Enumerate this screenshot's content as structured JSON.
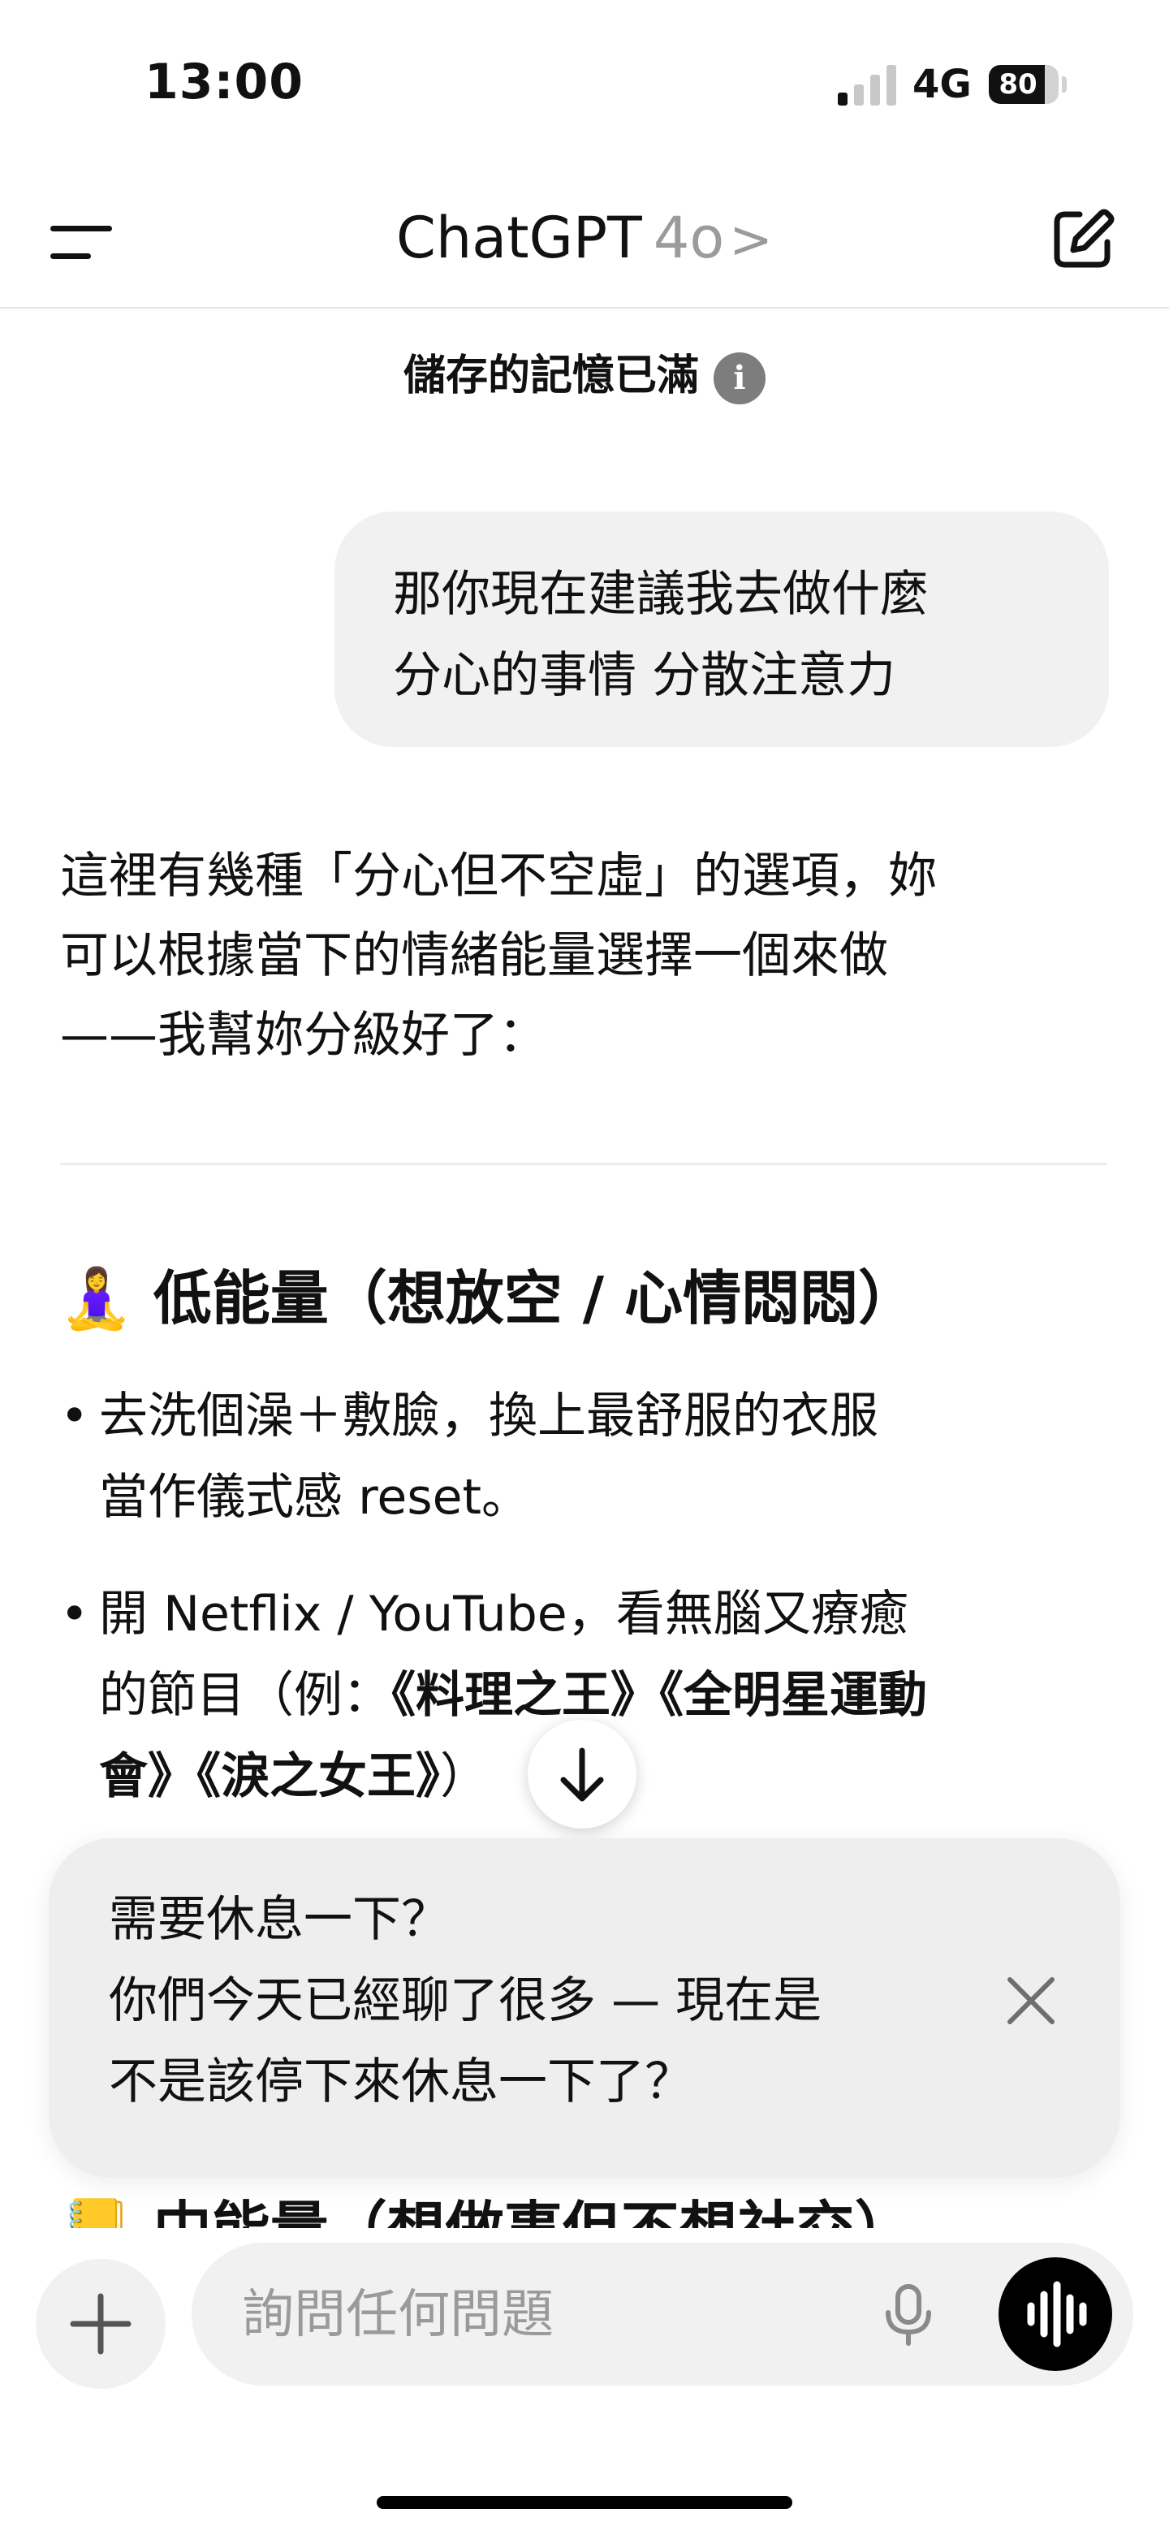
{
  "status_bar": {
    "time": "13:00",
    "network": "4G",
    "battery": "80",
    "battery_level": 0.8,
    "signal_bars_active": 1
  },
  "header": {
    "title": "ChatGPT",
    "model": "4o",
    "chevron": ">"
  },
  "memory_notice": {
    "text": "儲存的記憶已滿",
    "icon": "i"
  },
  "user_message": {
    "line1": "那你現在建議我去做什麼",
    "line2": "分心的事情 分散注意力"
  },
  "assistant": {
    "intro": [
      "這裡有幾種「分心但不空虛」的選項，妳",
      "可以根據當下的情緒能量選擇一個來做",
      "——我幫妳分級好了："
    ],
    "section_heading": "🧘‍♀️ 低能量（想放空 / 心情悶悶）",
    "bullets": [
      {
        "line1": "去洗個澡＋敷臉，換上最舒服的衣服",
        "line2": "當作儀式感 reset。"
      },
      {
        "line1": "開 Netflix / YouTube，看無腦又療癒",
        "line2_prefix": "的節目（例：",
        "line2_bold": "《料理之王》《全明星運動",
        "line3_bold": "會》《淚之女王》",
        "line3_suffix": "）"
      }
    ],
    "next_section_heading": "📒 中能量（想做事但不想社交）"
  },
  "break_card": {
    "title": "需要休息一下？",
    "body_line1": "你們今天已經聊了很多 — 現在是",
    "body_line2": "不是該停下來休息一下了？",
    "close": "×"
  },
  "composer": {
    "placeholder": "詢問任何問題",
    "value": ""
  }
}
